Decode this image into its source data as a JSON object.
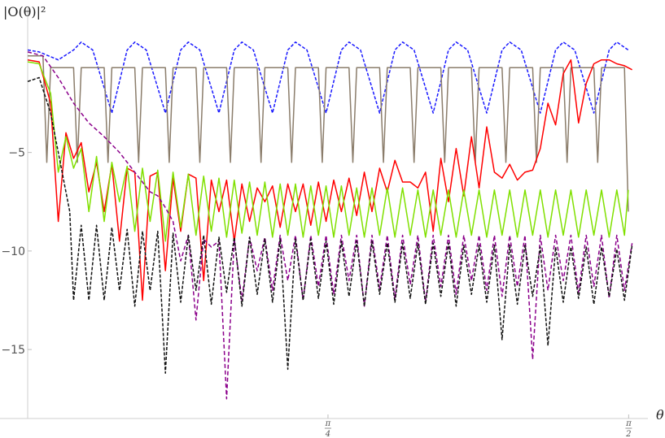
{
  "chart_data": {
    "type": "line",
    "title": "",
    "ylabel": "|O(θ)|²",
    "xlabel": "θ",
    "xlim": [
      0,
      1.6
    ],
    "ylim": [
      -18.5,
      1.5
    ],
    "grid": false,
    "legend": "none",
    "y_ticks": [
      {
        "value": -5,
        "label": "−5"
      },
      {
        "value": -10,
        "label": "−10"
      },
      {
        "value": -15,
        "label": "−15"
      }
    ],
    "x_ticks": [
      {
        "value": 0.785,
        "label_num": "π",
        "label_den": "4"
      },
      {
        "value": 1.571,
        "label_num": "π",
        "label_den": "2"
      }
    ],
    "series": [
      {
        "color": "#1a1aff",
        "dash": "4,2",
        "x": [
          0.0,
          0.03,
          0.08,
          0.12,
          0.14,
          0.17,
          0.22,
          0.26,
          0.28,
          0.31,
          0.36,
          0.4,
          0.42,
          0.45,
          0.5,
          0.54,
          0.56,
          0.59,
          0.64,
          0.68,
          0.7,
          0.73,
          0.78,
          0.82,
          0.84,
          0.87,
          0.92,
          0.96,
          0.98,
          1.01,
          1.06,
          1.1,
          1.12,
          1.15,
          1.2,
          1.24,
          1.26,
          1.29,
          1.34,
          1.38,
          1.4,
          1.43,
          1.48,
          1.52,
          1.54,
          1.57
        ],
        "y": [
          0.2,
          0.1,
          -0.3,
          0.2,
          0.6,
          0.2,
          -3.0,
          0.2,
          0.6,
          0.2,
          -3.0,
          0.2,
          0.6,
          0.2,
          -3.0,
          0.2,
          0.6,
          0.2,
          -3.0,
          0.2,
          0.6,
          0.2,
          -3.0,
          0.2,
          0.6,
          0.2,
          -3.0,
          0.2,
          0.6,
          0.2,
          -3.0,
          0.2,
          0.6,
          0.2,
          -3.0,
          0.2,
          0.6,
          0.2,
          -3.0,
          0.2,
          0.6,
          0.2,
          -3.0,
          0.2,
          0.6,
          0.2
        ]
      },
      {
        "color": "#8b7d6b",
        "dash": "",
        "x": [
          0.0,
          0.04,
          0.05,
          0.06,
          0.1,
          0.12,
          0.13,
          0.14,
          0.18,
          0.2,
          0.21,
          0.22,
          0.26,
          0.28,
          0.29,
          0.3,
          0.34,
          0.36,
          0.37,
          0.38,
          0.42,
          0.44,
          0.45,
          0.46,
          0.5,
          0.52,
          0.53,
          0.54,
          0.58,
          0.6,
          0.61,
          0.62,
          0.66,
          0.68,
          0.69,
          0.7,
          0.74,
          0.76,
          0.77,
          0.78,
          0.82,
          0.84,
          0.85,
          0.86,
          0.9,
          0.92,
          0.93,
          0.94,
          0.98,
          1.0,
          1.01,
          1.02,
          1.06,
          1.08,
          1.09,
          1.1,
          1.14,
          1.16,
          1.17,
          1.18,
          1.22,
          1.24,
          1.25,
          1.26,
          1.3,
          1.32,
          1.33,
          1.34,
          1.38,
          1.4,
          1.41,
          1.42,
          1.46,
          1.48,
          1.49,
          1.5,
          1.54,
          1.56,
          1.57
        ],
        "y": [
          -0.1,
          -0.1,
          -5.5,
          -0.7,
          -0.7,
          -0.7,
          -5.5,
          -0.7,
          -0.7,
          -0.7,
          -5.5,
          -0.7,
          -0.7,
          -0.7,
          -5.5,
          -0.7,
          -0.7,
          -0.7,
          -5.5,
          -0.7,
          -0.7,
          -0.7,
          -5.5,
          -0.7,
          -0.7,
          -0.7,
          -5.5,
          -0.7,
          -0.7,
          -0.7,
          -5.5,
          -0.7,
          -0.7,
          -0.7,
          -5.5,
          -0.7,
          -0.7,
          -0.7,
          -5.5,
          -0.7,
          -0.7,
          -0.7,
          -5.5,
          -0.7,
          -0.7,
          -0.7,
          -5.5,
          -0.7,
          -0.7,
          -0.7,
          -5.5,
          -0.7,
          -0.7,
          -0.7,
          -5.5,
          -0.7,
          -0.7,
          -0.7,
          -5.5,
          -0.7,
          -0.7,
          -0.7,
          -5.5,
          -0.7,
          -0.7,
          -0.7,
          -5.5,
          -0.7,
          -0.7,
          -0.7,
          -5.5,
          -0.7,
          -0.7,
          -0.7,
          -5.5,
          -0.7,
          -0.7,
          -0.7,
          -8.0
        ]
      },
      {
        "color": "#ff0000",
        "dash": "",
        "x": [
          0.0,
          0.03,
          0.06,
          0.08,
          0.1,
          0.12,
          0.14,
          0.16,
          0.18,
          0.2,
          0.22,
          0.24,
          0.26,
          0.28,
          0.3,
          0.32,
          0.34,
          0.36,
          0.38,
          0.4,
          0.42,
          0.44,
          0.46,
          0.48,
          0.5,
          0.52,
          0.54,
          0.56,
          0.58,
          0.6,
          0.62,
          0.64,
          0.66,
          0.68,
          0.7,
          0.72,
          0.74,
          0.76,
          0.78,
          0.8,
          0.82,
          0.84,
          0.86,
          0.88,
          0.9,
          0.92,
          0.94,
          0.96,
          0.98,
          1.0,
          1.02,
          1.04,
          1.06,
          1.08,
          1.1,
          1.12,
          1.14,
          1.16,
          1.18,
          1.2,
          1.22,
          1.24,
          1.26,
          1.28,
          1.3,
          1.32,
          1.34,
          1.36,
          1.38,
          1.4,
          1.42,
          1.44,
          1.46,
          1.48,
          1.5,
          1.52,
          1.54,
          1.56,
          1.58
        ],
        "y": [
          -0.3,
          -0.4,
          -2.5,
          -8.5,
          -4.0,
          -5.3,
          -4.5,
          -7.0,
          -5.5,
          -8.0,
          -5.6,
          -9.5,
          -5.8,
          -6.0,
          -12.5,
          -6.2,
          -6.0,
          -11.0,
          -6.3,
          -9.0,
          -6.1,
          -6.3,
          -11.5,
          -6.4,
          -8.0,
          -6.4,
          -9.5,
          -6.6,
          -8.5,
          -6.8,
          -7.5,
          -6.7,
          -8.8,
          -6.6,
          -8.0,
          -6.6,
          -8.7,
          -6.5,
          -8.5,
          -6.4,
          -8.0,
          -6.3,
          -8.2,
          -6.0,
          -8.0,
          -5.8,
          -7.0,
          -5.4,
          -6.5,
          -6.5,
          -6.8,
          -6.0,
          -9.0,
          -5.3,
          -7.5,
          -4.8,
          -7.2,
          -4.2,
          -6.8,
          -3.7,
          -6.0,
          -6.3,
          -5.6,
          -6.4,
          -6.0,
          -5.9,
          -4.8,
          -2.5,
          -3.6,
          -1.0,
          -0.3,
          -3.5,
          -1.5,
          -0.5,
          -0.3,
          -0.3,
          -0.5,
          -0.6,
          -0.8
        ]
      },
      {
        "color": "#80e000",
        "dash": "",
        "x": [
          0.0,
          0.03,
          0.06,
          0.08,
          0.1,
          0.12,
          0.14,
          0.16,
          0.18,
          0.2,
          0.22,
          0.24,
          0.26,
          0.28,
          0.3,
          0.32,
          0.34,
          0.36,
          0.38,
          0.4,
          0.42,
          0.44,
          0.46,
          0.48,
          0.5,
          0.52,
          0.54,
          0.56,
          0.58,
          0.6,
          0.62,
          0.64,
          0.66,
          0.68,
          0.7,
          0.72,
          0.74,
          0.76,
          0.78,
          0.8,
          0.82,
          0.84,
          0.86,
          0.88,
          0.9,
          0.92,
          0.94,
          0.96,
          0.98,
          1.0,
          1.02,
          1.04,
          1.06,
          1.08,
          1.1,
          1.12,
          1.14,
          1.16,
          1.18,
          1.2,
          1.22,
          1.24,
          1.26,
          1.28,
          1.3,
          1.32,
          1.34,
          1.36,
          1.38,
          1.4,
          1.42,
          1.44,
          1.46,
          1.48,
          1.5,
          1.52,
          1.54,
          1.56,
          1.57
        ],
        "y": [
          -0.4,
          -0.5,
          -2.0,
          -6.0,
          -4.2,
          -5.8,
          -4.8,
          -8.0,
          -5.2,
          -8.5,
          -5.5,
          -7.5,
          -5.7,
          -9.0,
          -5.8,
          -8.5,
          -5.9,
          -9.5,
          -6.0,
          -8.8,
          -6.1,
          -9.2,
          -6.2,
          -9.0,
          -6.3,
          -9.3,
          -6.4,
          -9.1,
          -6.5,
          -9.2,
          -6.5,
          -9.3,
          -6.6,
          -9.2,
          -6.6,
          -9.3,
          -6.7,
          -9.2,
          -6.7,
          -9.3,
          -6.7,
          -9.2,
          -6.8,
          -9.3,
          -6.8,
          -9.2,
          -6.8,
          -9.3,
          -6.8,
          -9.2,
          -6.9,
          -9.3,
          -6.9,
          -9.2,
          -6.9,
          -9.3,
          -6.9,
          -9.2,
          -6.9,
          -9.3,
          -6.9,
          -9.2,
          -6.9,
          -9.3,
          -6.9,
          -9.2,
          -6.9,
          -9.3,
          -6.9,
          -9.2,
          -6.9,
          -9.3,
          -6.9,
          -9.2,
          -6.9,
          -9.3,
          -6.9,
          -9.2,
          -6.9
        ]
      },
      {
        "color": "#8b008b",
        "dash": "5,3",
        "x": [
          0.0,
          0.04,
          0.08,
          0.12,
          0.16,
          0.2,
          0.24,
          0.28,
          0.3,
          0.32,
          0.34,
          0.36,
          0.38,
          0.4,
          0.42,
          0.44,
          0.46,
          0.48,
          0.5,
          0.52,
          0.54,
          0.56,
          0.58,
          0.6,
          0.62,
          0.64,
          0.66,
          0.68,
          0.7,
          0.72,
          0.74,
          0.76,
          0.78,
          0.8,
          0.82,
          0.84,
          0.86,
          0.88,
          0.9,
          0.92,
          0.94,
          0.96,
          0.98,
          1.0,
          1.02,
          1.04,
          1.06,
          1.08,
          1.1,
          1.12,
          1.14,
          1.16,
          1.18,
          1.2,
          1.22,
          1.24,
          1.26,
          1.28,
          1.3,
          1.32,
          1.34,
          1.36,
          1.38,
          1.4,
          1.42,
          1.44,
          1.46,
          1.48,
          1.5,
          1.52,
          1.54,
          1.56,
          1.58
        ],
        "y": [
          0.1,
          -0.1,
          -1.2,
          -2.5,
          -3.5,
          -4.2,
          -5.0,
          -6.0,
          -6.5,
          -7.0,
          -7.2,
          -7.8,
          -8.5,
          -10.5,
          -9.2,
          -13.5,
          -9.4,
          -9.8,
          -9.5,
          -17.5,
          -9.4,
          -12.5,
          -9.3,
          -11.0,
          -9.3,
          -12.0,
          -9.2,
          -11.5,
          -9.2,
          -12.5,
          -9.2,
          -11.8,
          -9.2,
          -12.2,
          -9.2,
          -11.5,
          -9.2,
          -12.8,
          -9.2,
          -11.9,
          -9.2,
          -12.4,
          -9.2,
          -11.7,
          -9.2,
          -12.6,
          -9.2,
          -11.8,
          -9.2,
          -12.2,
          -9.2,
          -11.5,
          -9.2,
          -12.0,
          -9.2,
          -12.3,
          -9.2,
          -11.8,
          -9.2,
          -15.5,
          -9.2,
          -12.0,
          -9.2,
          -11.5,
          -9.2,
          -12.1,
          -9.2,
          -11.8,
          -9.2,
          -12.4,
          -9.2,
          -12.0,
          -9.6
        ]
      },
      {
        "color": "#111111",
        "dash": "4,2",
        "x": [
          0.0,
          0.03,
          0.06,
          0.09,
          0.11,
          0.12,
          0.14,
          0.16,
          0.18,
          0.2,
          0.22,
          0.24,
          0.26,
          0.28,
          0.3,
          0.32,
          0.34,
          0.36,
          0.38,
          0.4,
          0.42,
          0.44,
          0.46,
          0.48,
          0.5,
          0.52,
          0.54,
          0.56,
          0.58,
          0.6,
          0.62,
          0.64,
          0.66,
          0.68,
          0.7,
          0.72,
          0.74,
          0.76,
          0.78,
          0.8,
          0.82,
          0.84,
          0.86,
          0.88,
          0.9,
          0.92,
          0.94,
          0.96,
          0.98,
          1.0,
          1.02,
          1.04,
          1.06,
          1.08,
          1.1,
          1.12,
          1.14,
          1.16,
          1.18,
          1.2,
          1.22,
          1.24,
          1.26,
          1.28,
          1.3,
          1.32,
          1.34,
          1.36,
          1.38,
          1.4,
          1.42,
          1.44,
          1.46,
          1.48,
          1.5,
          1.52,
          1.54,
          1.56,
          1.58
        ],
        "y": [
          -1.4,
          -1.2,
          -3.0,
          -6.0,
          -8.0,
          -12.5,
          -8.7,
          -12.5,
          -8.7,
          -12.5,
          -8.8,
          -12.0,
          -8.9,
          -12.8,
          -9.0,
          -12.0,
          -9.0,
          -16.2,
          -9.1,
          -12.6,
          -9.2,
          -12.0,
          -9.2,
          -12.7,
          -9.3,
          -12.1,
          -9.3,
          -12.8,
          -9.3,
          -12.2,
          -9.4,
          -12.6,
          -9.4,
          -16.0,
          -9.4,
          -12.5,
          -9.4,
          -12.4,
          -9.5,
          -12.7,
          -9.5,
          -12.3,
          -9.5,
          -12.8,
          -9.5,
          -12.2,
          -9.6,
          -12.6,
          -9.6,
          -12.4,
          -9.6,
          -12.7,
          -9.6,
          -12.3,
          -9.6,
          -12.8,
          -9.7,
          -12.2,
          -9.7,
          -12.6,
          -9.7,
          -14.5,
          -9.7,
          -12.7,
          -9.7,
          -12.3,
          -9.8,
          -14.8,
          -9.8,
          -12.6,
          -9.8,
          -12.4,
          -9.8,
          -12.7,
          -9.8,
          -12.3,
          -9.9,
          -12.5,
          -9.7
        ]
      }
    ]
  }
}
